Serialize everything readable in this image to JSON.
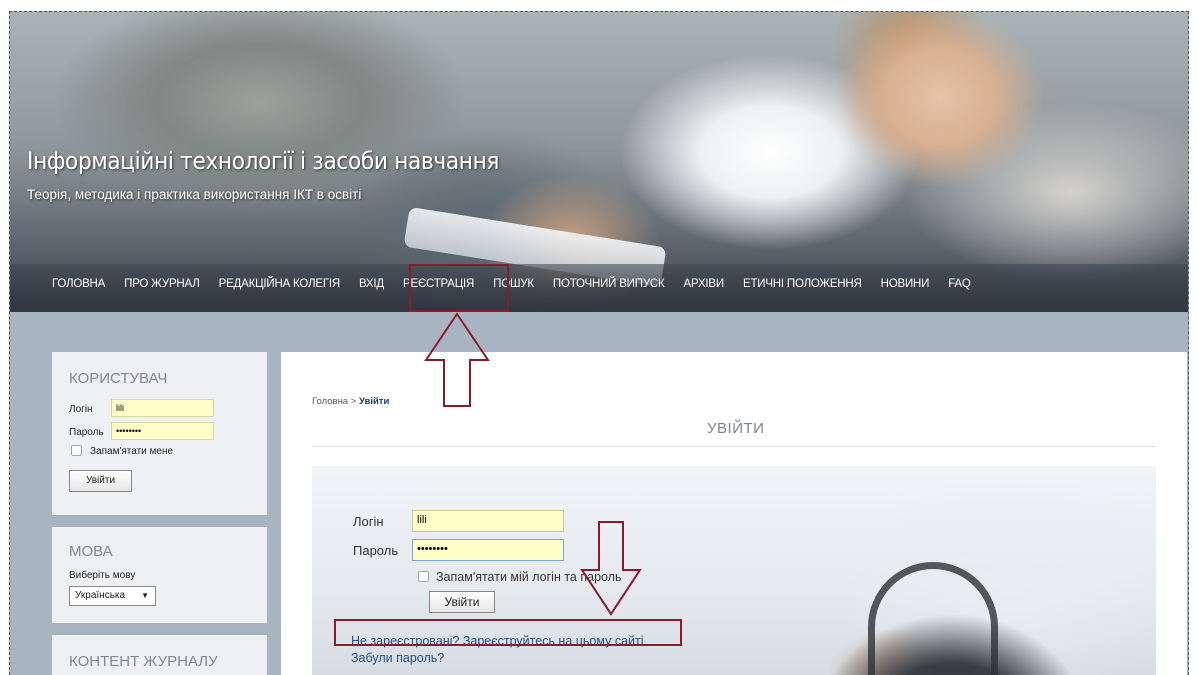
{
  "header": {
    "title": "Інформаційні технології і засоби навчання",
    "subtitle": "Теорія, методика і практика використання ІКТ в освіті"
  },
  "nav": {
    "items": [
      {
        "label": "Головна"
      },
      {
        "label": "Про журнал"
      },
      {
        "label": "Редакційна колегія"
      },
      {
        "label": "Вхід"
      },
      {
        "label": "Реєстрація"
      },
      {
        "label": "Пошук"
      },
      {
        "label": "Поточний випуск"
      },
      {
        "label": "Архіви"
      },
      {
        "label": "Етичні положення"
      },
      {
        "label": "Новини"
      },
      {
        "label": "FAQ"
      }
    ]
  },
  "sidebar": {
    "user": {
      "title": "Користувач",
      "login_label": "Логін",
      "login_value": "lili",
      "password_label": "Пароль",
      "password_value": "••••••••",
      "remember_label": "Запам'ятати мене",
      "submit_label": "Увійти"
    },
    "language": {
      "title": "Мова",
      "choose_label": "Виберіть мову",
      "selected": "Українська"
    },
    "content": {
      "title": "Контент журналу"
    }
  },
  "main": {
    "breadcrumb": {
      "home": "Головна",
      "separator": ">",
      "current": "Увійти"
    },
    "heading": "Увійти",
    "form": {
      "login_label": "Логін",
      "login_value": "lili",
      "password_label": "Пароль",
      "password_value": "••••••••",
      "remember_label": "Запам'ятати мій логін та пароль",
      "submit_label": "Увійти",
      "register_link": "Не зареєстровані? Зареєструйтесь на цьому сайті",
      "forgot_link": "Забули пароль?"
    }
  },
  "colors": {
    "annotation": "#8b1a2b",
    "nav_bar": "#3c444e",
    "input_highlight": "#ffffc8",
    "link": "#1f4e8c"
  }
}
